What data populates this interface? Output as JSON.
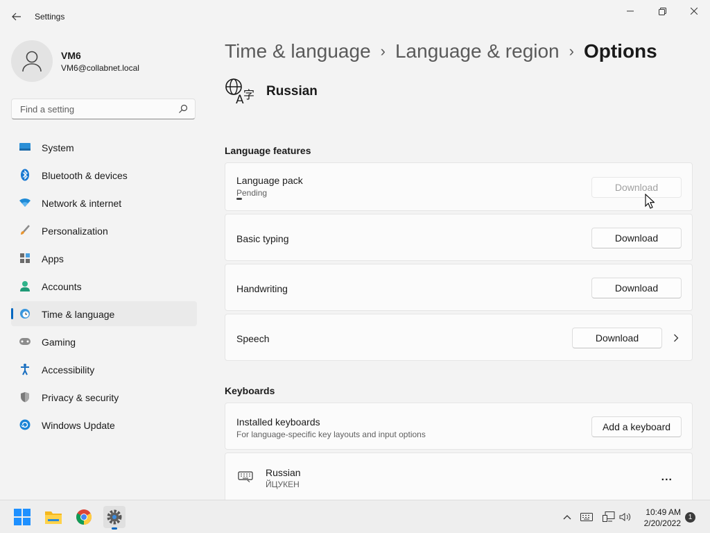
{
  "window": {
    "title": "Settings",
    "controls": {
      "minimize": "minimize-icon",
      "maximize": "restore-icon",
      "close": "close-icon"
    }
  },
  "profile": {
    "name": "VM6",
    "email": "VM6@collabnet.local"
  },
  "search": {
    "placeholder": "Find a setting",
    "value": ""
  },
  "sidebar": {
    "items": [
      {
        "label": "System",
        "icon": "system-icon"
      },
      {
        "label": "Bluetooth & devices",
        "icon": "bluetooth-icon"
      },
      {
        "label": "Network & internet",
        "icon": "wifi-icon"
      },
      {
        "label": "Personalization",
        "icon": "brush-icon"
      },
      {
        "label": "Apps",
        "icon": "apps-icon"
      },
      {
        "label": "Accounts",
        "icon": "accounts-icon"
      },
      {
        "label": "Time & language",
        "icon": "clock-globe-icon",
        "active": true
      },
      {
        "label": "Gaming",
        "icon": "gamepad-icon"
      },
      {
        "label": "Accessibility",
        "icon": "accessibility-icon"
      },
      {
        "label": "Privacy & security",
        "icon": "shield-icon"
      },
      {
        "label": "Windows Update",
        "icon": "update-icon"
      }
    ]
  },
  "breadcrumb": {
    "level1": "Time & language",
    "level2": "Language & region",
    "current": "Options"
  },
  "language": {
    "name": "Russian",
    "icon": "language-icon"
  },
  "features": {
    "heading": "Language features",
    "items": [
      {
        "title": "Language pack",
        "status": "Pending",
        "button": "Download",
        "disabled": true,
        "progress": 0.03
      },
      {
        "title": "Basic typing",
        "button": "Download"
      },
      {
        "title": "Handwriting",
        "button": "Download"
      },
      {
        "title": "Speech",
        "button": "Download"
      }
    ]
  },
  "keyboards": {
    "heading": "Keyboards",
    "installed": {
      "title": "Installed keyboards",
      "description": "For language-specific key layouts and input options",
      "button": "Add a keyboard"
    },
    "items": [
      {
        "name": "Russian",
        "layout": "ЙЦУКЕН",
        "more": "..."
      }
    ]
  },
  "taskbar": {
    "apps": [
      "start-icon",
      "file-explorer-icon",
      "chrome-icon",
      "settings-icon"
    ],
    "time": "10:49 AM",
    "date": "2/20/2022",
    "notifications": "1"
  },
  "colors": {
    "accent": "#0067c0",
    "background": "#f3f3f3",
    "card": "#fbfbfb"
  }
}
